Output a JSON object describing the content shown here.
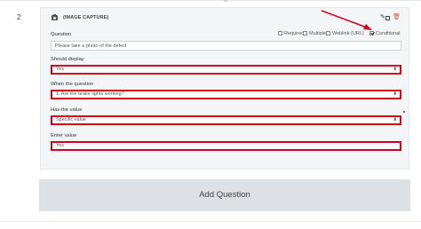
{
  "question": {
    "number": "2",
    "type_label": "(IMAGE CAPTURE)",
    "icons": {
      "type_icon": "camera-icon",
      "edit": "pencil-icon",
      "copy": "copy-icon",
      "delete": "trash-icon"
    },
    "options": [
      {
        "label": "Required",
        "checked": false
      },
      {
        "label": "Multiple",
        "checked": false
      },
      {
        "label": "Weblink (URL)",
        "checked": false
      },
      {
        "label": "Conditional",
        "checked": true
      }
    ],
    "question_label": "Question",
    "question_value": "Please take a photo of the defect",
    "should_display_label": "Should display",
    "should_display_value": "Yes",
    "when_label": "When the question",
    "when_value": "1. Are the brake lights working?",
    "has_value_label": "Has the value",
    "has_value_value": "Specific value",
    "enter_value_label": "Enter value",
    "enter_value_value": "Yes"
  },
  "add_question_label": "Add Question",
  "colors": {
    "highlight": "#d0021b",
    "card_bg": "#f4f5f7",
    "button_bg": "#dde0e4",
    "delete": "#d9534f"
  }
}
